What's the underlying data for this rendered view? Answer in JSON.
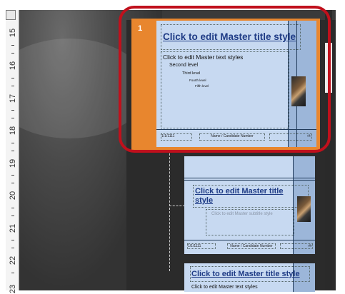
{
  "ruler": {
    "marks": [
      "15",
      "16",
      "17",
      "18",
      "19",
      "20",
      "21",
      "22",
      "23"
    ]
  },
  "slide1": {
    "number": "1",
    "title": "Click to edit Master title style",
    "body_levels": [
      "Click to edit Master text styles",
      "Second level",
      "Third level",
      "Fourth level",
      "Fifth level"
    ],
    "footer_date": "1/1/1111",
    "footer_center": "Name / Candidate Number",
    "footer_page": "‹#›"
  },
  "slide2": {
    "title_line1": "Click to edit Master title",
    "title_line2": "style",
    "subtitle": "Click to edit Master subtitle style",
    "footer_date": "1/1/1111",
    "footer_center": "Name / Candidate Number",
    "footer_page": "‹#›"
  },
  "slide3": {
    "title": "Click to edit Master title style",
    "body_first": "Click to edit Master text styles"
  },
  "colors": {
    "highlight": "#c0101c",
    "selection": "#e8862e",
    "slide_bg": "#c7d9f1",
    "title": "#1f3c86"
  }
}
